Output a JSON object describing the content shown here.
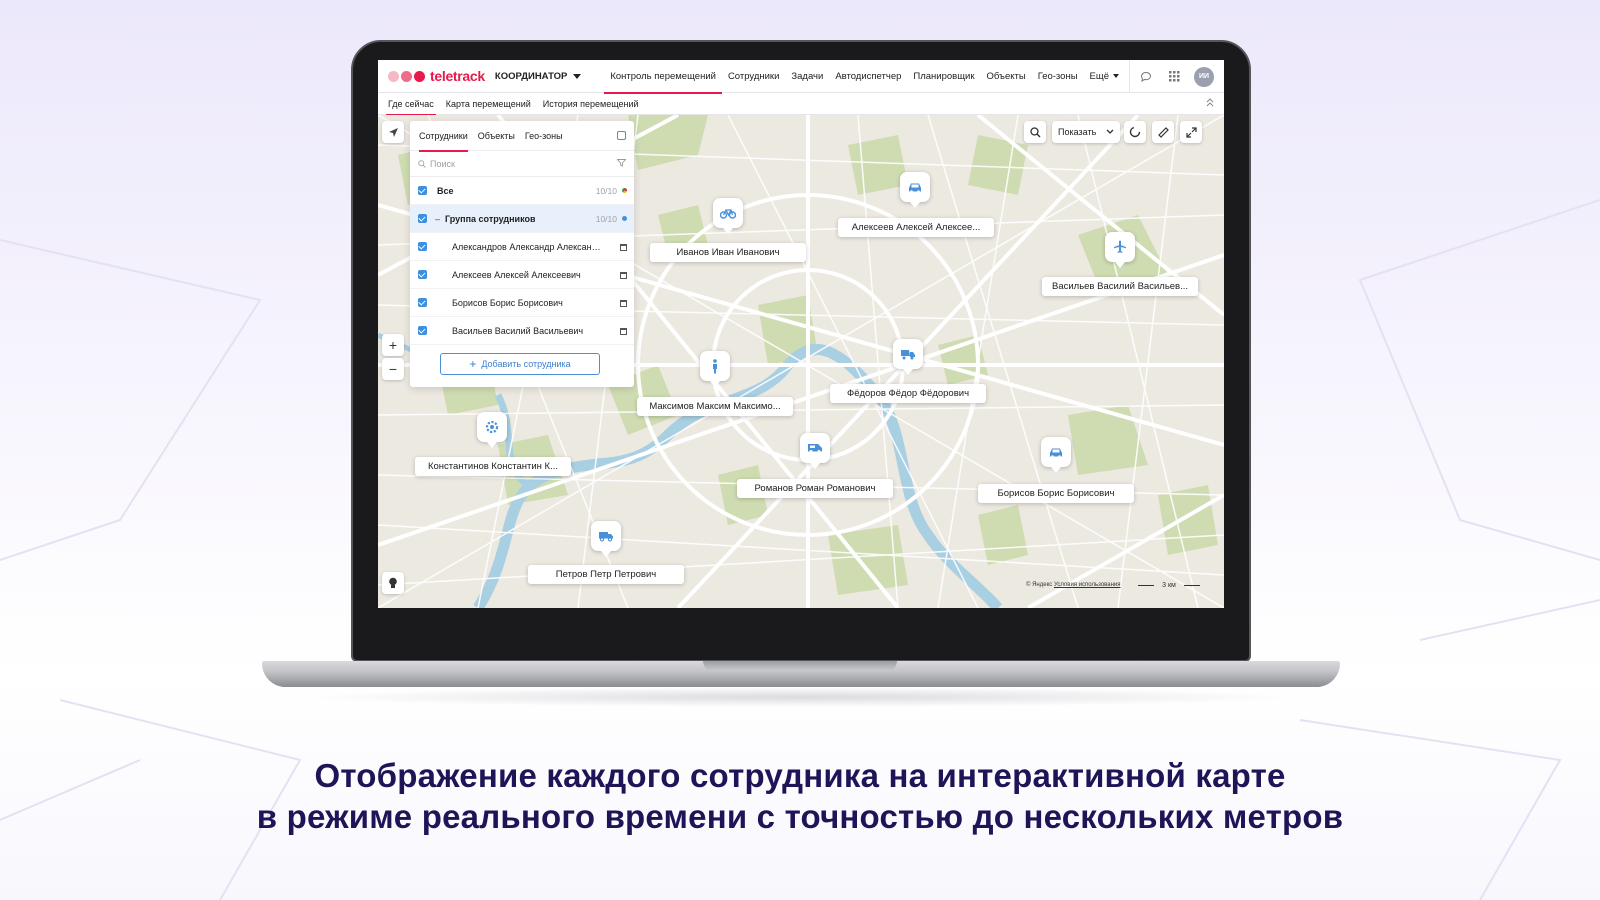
{
  "app": {
    "brand": "teletrack",
    "brand_dot_colors": [
      "#f7b8c5",
      "#ef6b87",
      "#e8194b"
    ],
    "role": "КООРДИНАТОР",
    "nav": [
      "Контроль перемещений",
      "Сотрудники",
      "Задачи",
      "Автодиспетчер",
      "Планировщик",
      "Объекты",
      "Гео-зоны",
      "Ещё"
    ],
    "nav_active": "Контроль перемещений",
    "user_initials": "ИИ",
    "subnav": [
      "Где сейчас",
      "Карта перемещений",
      "История перемещений"
    ],
    "subnav_active": "Где сейчас"
  },
  "panel": {
    "tabs": [
      "Сотрудники",
      "Объекты",
      "Гео-зоны"
    ],
    "search_placeholder": "Поиск",
    "all_label": "Все",
    "all_count": "10/10",
    "group_label": "Группа сотрудников",
    "group_count": "10/10",
    "employees": [
      "Александров Александр Александрович",
      "Алексеев Алексей Алексеевич",
      "Борисов Борис Борисович",
      "Васильев Василий Васильевич"
    ],
    "add_button": "Добавить сотрудника"
  },
  "map": {
    "show_button": "Показать",
    "zoom_in": "+",
    "zoom_out": "−",
    "attribution": "© Яндекс",
    "terms": "Условия использования",
    "scale": "3 км",
    "markers": [
      {
        "name": "Иванов Иван Иванович",
        "icon": "bicycle-icon"
      },
      {
        "name": "Алексеев Алексей Алексее...",
        "icon": "car-icon"
      },
      {
        "name": "Васильев Василий Васильев...",
        "icon": "airplane-icon"
      },
      {
        "name": "Фёдоров Фёдор Фёдорович",
        "icon": "cement-truck-icon"
      },
      {
        "name": "Максимов Максим Максимо...",
        "icon": "walking-person-icon"
      },
      {
        "name": "Константинов Константин К...",
        "icon": "gear-icon"
      },
      {
        "name": "Романов Роман Романович",
        "icon": "van-icon"
      },
      {
        "name": "Борисов Борис Борисович",
        "icon": "car-icon"
      },
      {
        "name": "Петров Петр Петрович",
        "icon": "truck-icon"
      }
    ],
    "accent": "#4a90d9"
  },
  "caption": {
    "line1": "Отображение каждого сотрудника на интерактивной карте",
    "line2": "в режиме реального времени с точностью до нескольких метров"
  }
}
